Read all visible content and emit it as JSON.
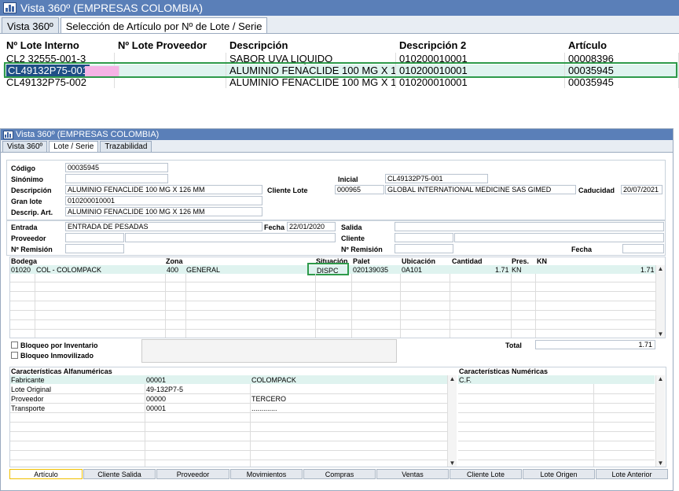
{
  "top": {
    "title": "Vista 360º (EMPRESAS COLOMBIA)",
    "tabs": [
      "Vista 360º",
      "Selección de Artículo por Nº de Lote / Serie"
    ],
    "columns": [
      "Nº Lote Interno",
      "Nº Lote Proveedor",
      "Descripción",
      "Descripción 2",
      "Artículo"
    ],
    "rows": [
      {
        "lote": "CL2 32555-001-3",
        "proveedor": "",
        "descripcion": "SABOR UVA LIQUIDO",
        "descripcion2": "010200010001",
        "articulo": "00008396"
      },
      {
        "lote": "CL49132P75-001",
        "proveedor": "",
        "descripcion": "ALUMINIO FENACLIDE 100 MG  X 126",
        "descripcion2": "010200010001",
        "articulo": "00035945"
      },
      {
        "lote": "CL49132P75-002",
        "proveedor": "",
        "descripcion": "ALUMINIO FENACLIDE 100 MG  X 126",
        "descripcion2": "010200010001",
        "articulo": "00035945"
      }
    ]
  },
  "bottom": {
    "title": "Vista 360º (EMPRESAS COLOMBIA)",
    "tabs": [
      "Vista 360º",
      "Lote / Serie",
      "Trazabilidad"
    ],
    "labels": {
      "codigo": "Código",
      "sinonimo": "Sinónimo",
      "descripcion": "Descripción",
      "gran_lote": "Gran lote",
      "descrip_art": "Descrip. Art.",
      "inicial": "Inicial",
      "cliente_lote": "Cliente Lote",
      "caducidad": "Caducidad",
      "entrada": "Entrada",
      "fecha": "Fecha",
      "proveedor": "Proveedor",
      "remision": "Nº Remisión",
      "salida": "Salida",
      "cliente": "Cliente",
      "remision2": "Nº Remisión",
      "fecha2": "Fecha"
    },
    "values": {
      "codigo": "00035945",
      "sinonimo": "",
      "descripcion": "ALUMINIO FENACLIDE 100 MG  X 126 MM",
      "gran_lote": "010200010001",
      "descrip_art": "ALUMINIO FENACLIDE 100 MG  X 126 MM",
      "inicial": "CL49132P75-001",
      "cliente_code": "000965",
      "cliente_name": "GLOBAL INTERNATIONAL MEDICINE SAS GIMED",
      "caducidad": "20/07/2021",
      "entrada": "ENTRADA DE PESADAS",
      "fecha": "22/01/2020"
    },
    "stock_columns": [
      "Bodega",
      "Zona",
      "Situación",
      "Palet",
      "Ubicación",
      "Cantidad",
      "Pres.",
      "KN"
    ],
    "stock_row": {
      "bodega_code": "01020",
      "bodega": "COL - COLOMPACK",
      "zona_code": "400",
      "zona": "GENERAL",
      "situacion": "DISPC",
      "palet": "020139035",
      "ubicacion": "0A101",
      "cantidad": "1.71",
      "pres": "KN",
      "kn": "1.71"
    },
    "bloqueo_inventario": "Bloqueo por Inventario",
    "bloqueo_inmovilizado": "Bloqueo Inmovilizado",
    "total_label": "Total",
    "total_value": "1.71",
    "alfa_title": "Características Alfanuméricas",
    "num_title": "Características Numéricas",
    "alfa_rows": [
      {
        "name": "Fabricante",
        "code": "00001",
        "value": "COLOMPACK"
      },
      {
        "name": "Lote Original",
        "code": "49-132P7-5",
        "value": ""
      },
      {
        "name": "Proveedor",
        "code": "00000",
        "value": "TERCERO"
      },
      {
        "name": "Transporte",
        "code": "00001",
        "value": "............."
      }
    ],
    "num_rows": [
      {
        "name": "C.F.",
        "value": ""
      }
    ],
    "buttons": [
      "Artículo",
      "Cliente Salida",
      "Proveedor",
      "Movimientos",
      "Compras",
      "Ventas",
      "Cliente Lote",
      "Lote Origen",
      "Lote Anterior"
    ]
  }
}
